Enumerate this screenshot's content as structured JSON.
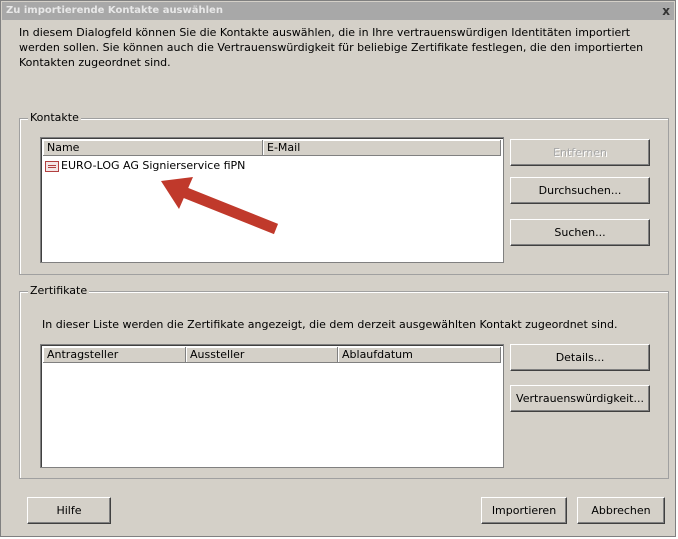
{
  "dialog": {
    "title": "Zu importierende Kontakte auswählen",
    "close_glyph": "x",
    "description": "In diesem Dialogfeld können Sie die Kontakte auswählen, die in Ihre vertrauenswürdigen Identitäten importiert werden sollen. Sie können auch die Vertrauenswürdigkeit für beliebige Zertifikate festlegen, die den importierten Kontakten zugeordnet sind."
  },
  "contacts": {
    "legend": "Kontakte",
    "columns": [
      "Name",
      "E-Mail"
    ],
    "rows": [
      {
        "icon": "certificate-icon",
        "name": "EURO-LOG AG Signierservice fiPN",
        "email": ""
      }
    ],
    "buttons": {
      "remove": "Entfernen",
      "browse": "Durchsuchen...",
      "search": "Suchen..."
    }
  },
  "certificates": {
    "legend": "Zertifikate",
    "description": "In dieser Liste werden die Zertifikate angezeigt, die dem derzeit ausgewählten Kontakt zugeordnet sind.",
    "columns": [
      "Antragsteller",
      "Aussteller",
      "Ablaufdatum"
    ],
    "buttons": {
      "details": "Details...",
      "trust": "Vertrauenswürdigkeit..."
    }
  },
  "footer": {
    "help": "Hilfe",
    "import": "Importieren",
    "cancel": "Abbrechen"
  },
  "annotation": {
    "color": "#c0392b"
  }
}
